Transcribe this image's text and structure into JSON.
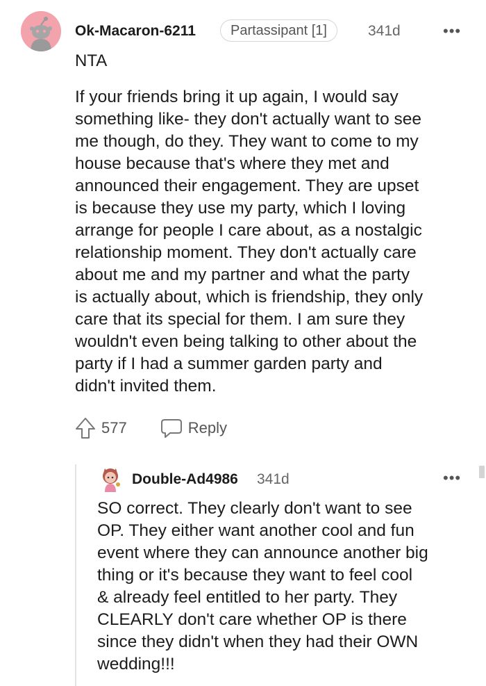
{
  "comment": {
    "username": "Ok-Macaron-6211",
    "flair": "Partassipant [1]",
    "age": "341d",
    "more": "•••",
    "verdict": "NTA",
    "body": "If your friends bring it up again, I would say\nsomething like- they don't actually want to see\nme though, do they. They want to come to my\nhouse because that's where they met and\nannounced their engagement. They are upset\nis because they use my party, which I loving\narrange for people I care about, as a nostalgic\nrelationship moment. They don't actually care\nabout me and my partner and what the party\nis actually about, which is friendship, they only\ncare that its special for them. I am sure they\nwouldn't even being talking to other about the\nparty if I had a summer garden party and\ndidn't invited them.",
    "upvotes": "577",
    "reply_label": "Reply",
    "avatar_icon": "reddit-snoo-avatar",
    "avatar_color": "#f2a3ab"
  },
  "reply": {
    "username": "Double-Ad4986",
    "age": "341d",
    "more": "•••",
    "body": "SO correct. They clearly don't want to see\nOP. They either want another cool and fun\nevent where they can announce another big\nthing or it's because they want to feel cool\n& already feel entitled to her party. They\nCLEARLY don't care whether OP is there\nsince they didn't when they had their OWN\nwedding!!!",
    "avatar_icon": "cartoon-avatar"
  }
}
